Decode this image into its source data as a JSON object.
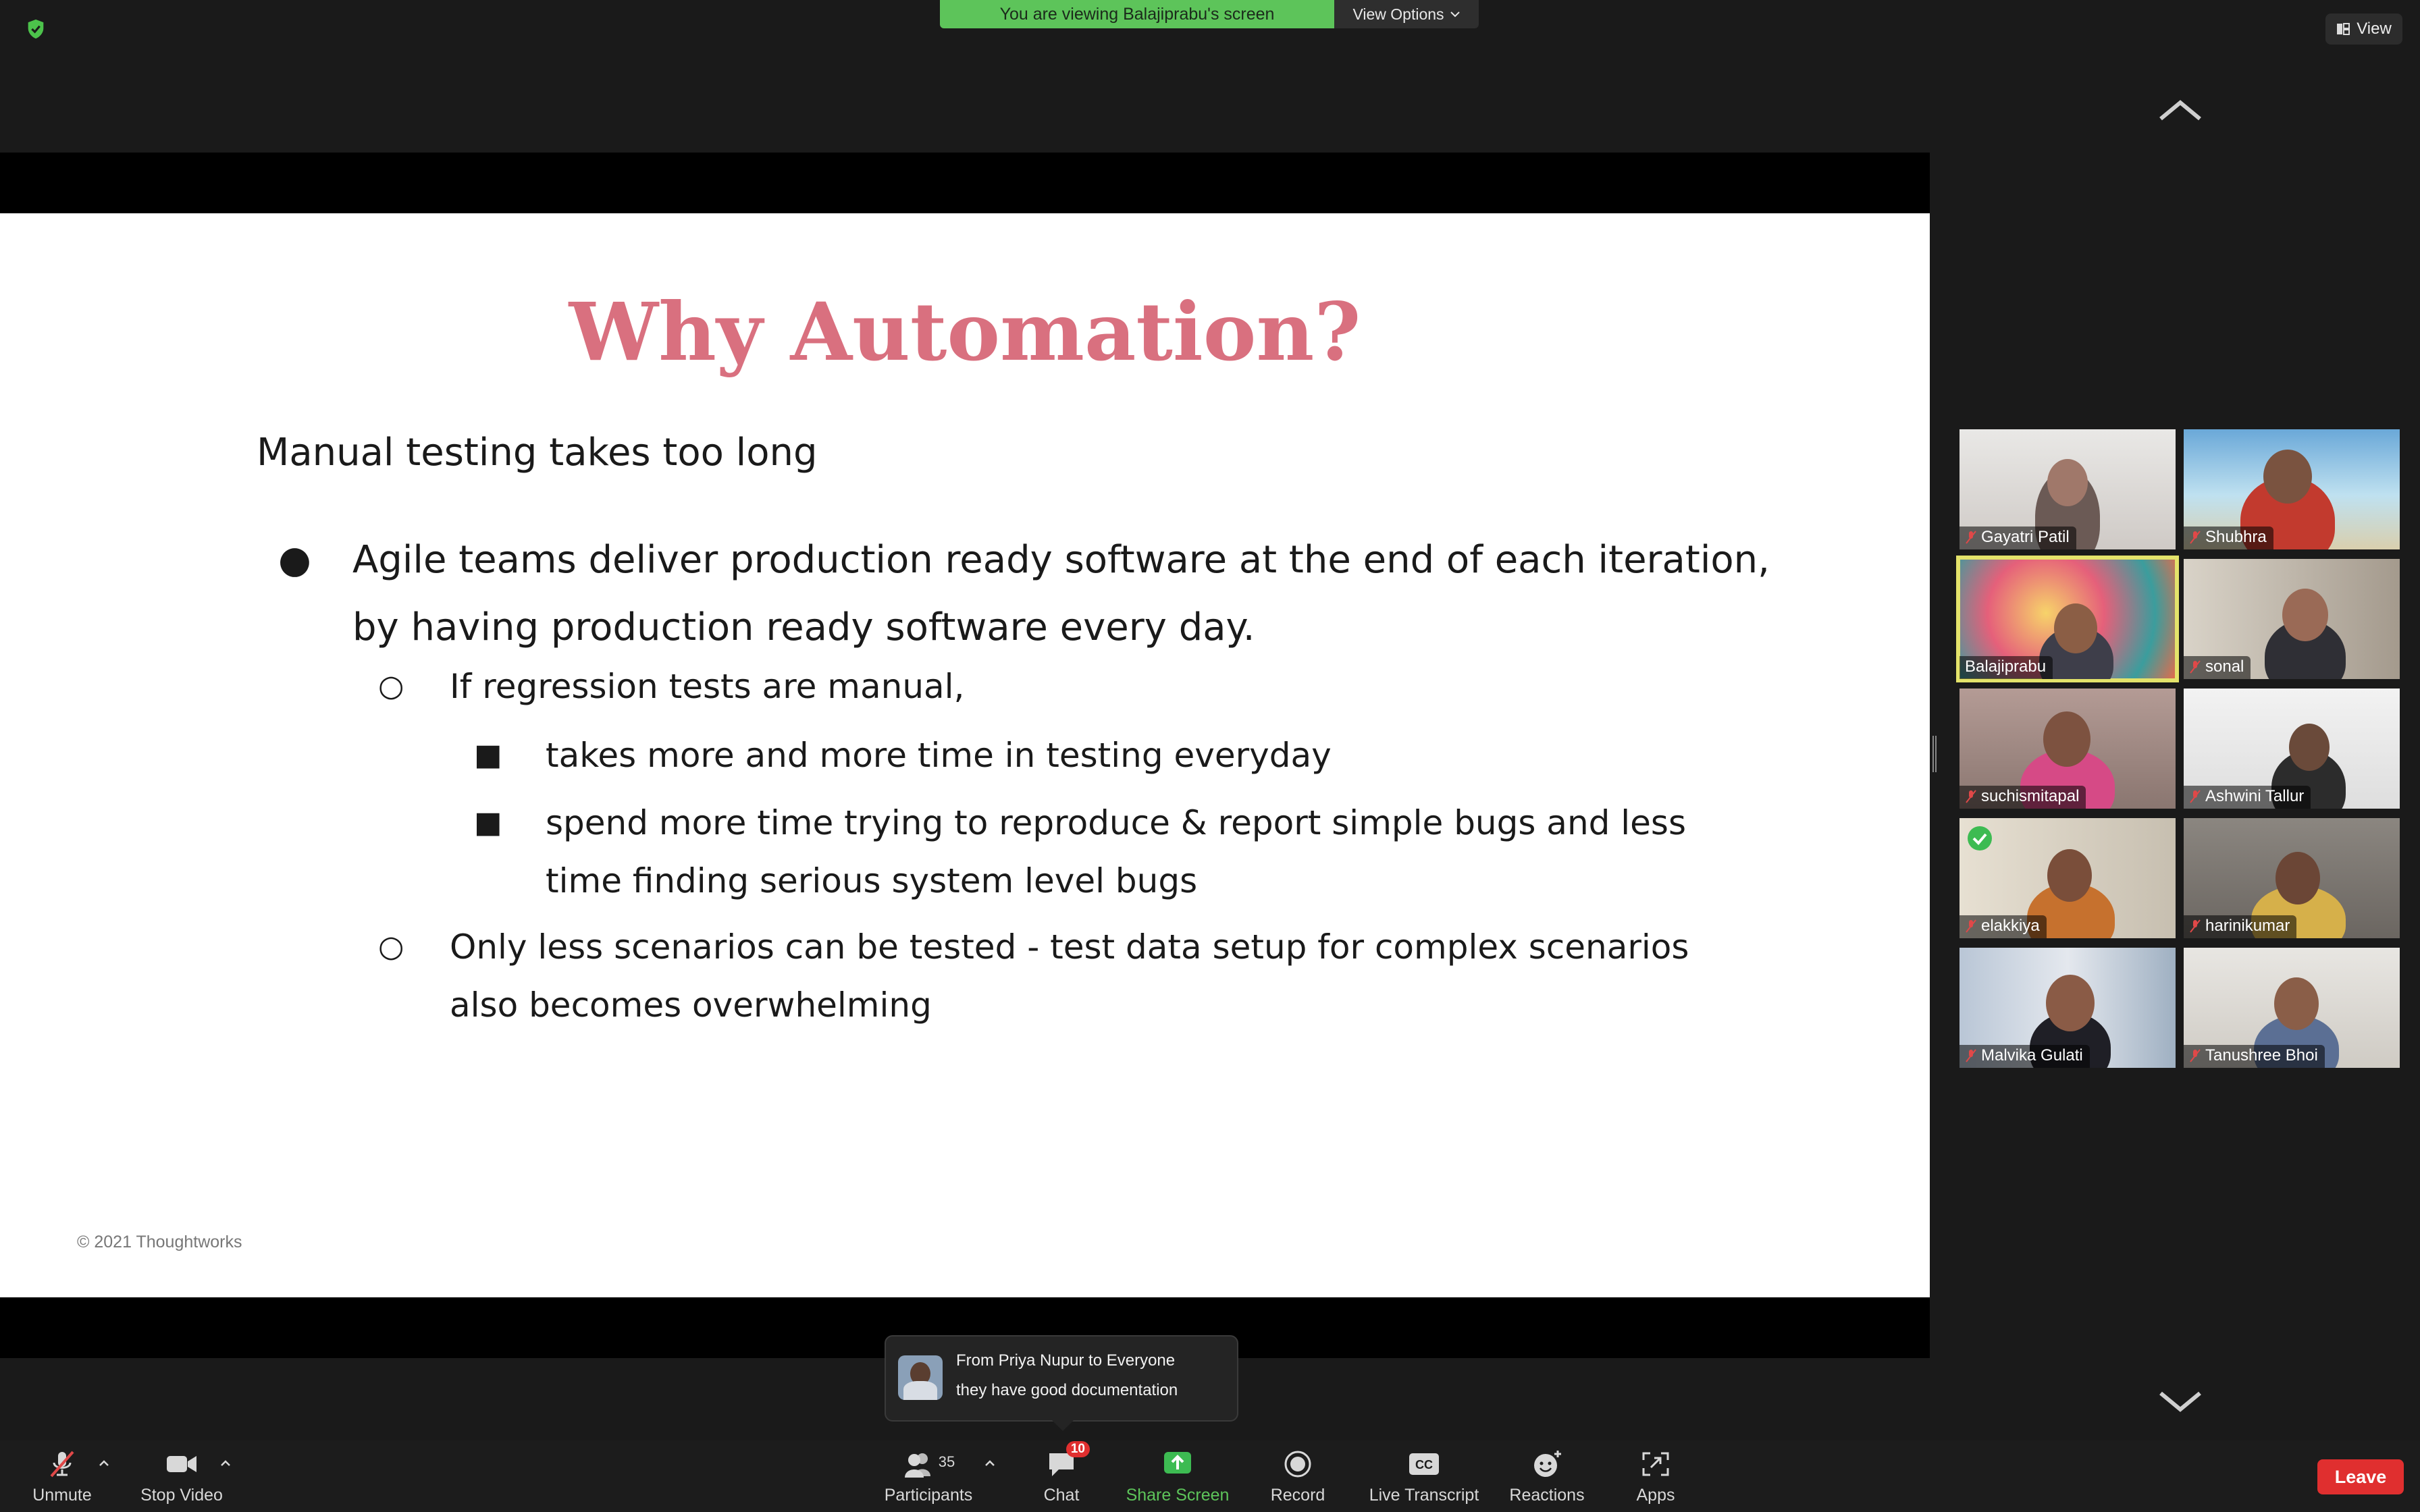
{
  "banner": {
    "viewing": "You are viewing Balajiprabu's screen",
    "view_options": "View Options"
  },
  "view_button": "View",
  "slide": {
    "title": "Why Automation?",
    "intro": "Manual testing takes too long",
    "bullet1": "Agile teams deliver production ready software at the end of each iteration, by having production ready software every day.",
    "sub1": "If regression tests are manual,",
    "sub1_items": [
      "takes more and more time in testing everyday",
      "spend more time trying to reproduce & report simple bugs and less time finding serious system level bugs"
    ],
    "sub2": "Only less scenarios can be tested - test data setup for complex scenarios also becomes overwhelming",
    "bullet_glyph": "●",
    "sub_glyph": "○",
    "item_glyph": "■",
    "copyright": "© 2021 Thoughtworks"
  },
  "participants": [
    {
      "name": "Gayatri Patil",
      "muted": true,
      "active": false
    },
    {
      "name": "Shubhra",
      "muted": true,
      "active": false
    },
    {
      "name": "Balajiprabu",
      "muted": false,
      "active": true
    },
    {
      "name": "sonal",
      "muted": true,
      "active": false
    },
    {
      "name": "suchismitapal",
      "muted": true,
      "active": false
    },
    {
      "name": "Ashwini Tallur",
      "muted": true,
      "active": false
    },
    {
      "name": "elakkiya",
      "muted": true,
      "active": false
    },
    {
      "name": "harinikumar",
      "muted": true,
      "active": false
    },
    {
      "name": "Malvika Gulati",
      "muted": true,
      "active": false
    },
    {
      "name": "Tanushree Bhoi",
      "muted": true,
      "active": false
    }
  ],
  "chat_toast": {
    "from": "From Priya Nupur to Everyone",
    "message": "they have good documentation"
  },
  "toolbar": {
    "unmute": "Unmute",
    "stop_video": "Stop Video",
    "participants": "Participants",
    "participants_count": "35",
    "chat": "Chat",
    "chat_badge": "10",
    "share_screen": "Share Screen",
    "record": "Record",
    "live_transcript": "Live Transcript",
    "reactions": "Reactions",
    "apps": "Apps",
    "leave": "Leave"
  },
  "colors": {
    "accent_green": "#5dc45a",
    "leave_red": "#e02f2f",
    "title_pink": "#d9707f",
    "active_speaker": "#e4e36b"
  }
}
